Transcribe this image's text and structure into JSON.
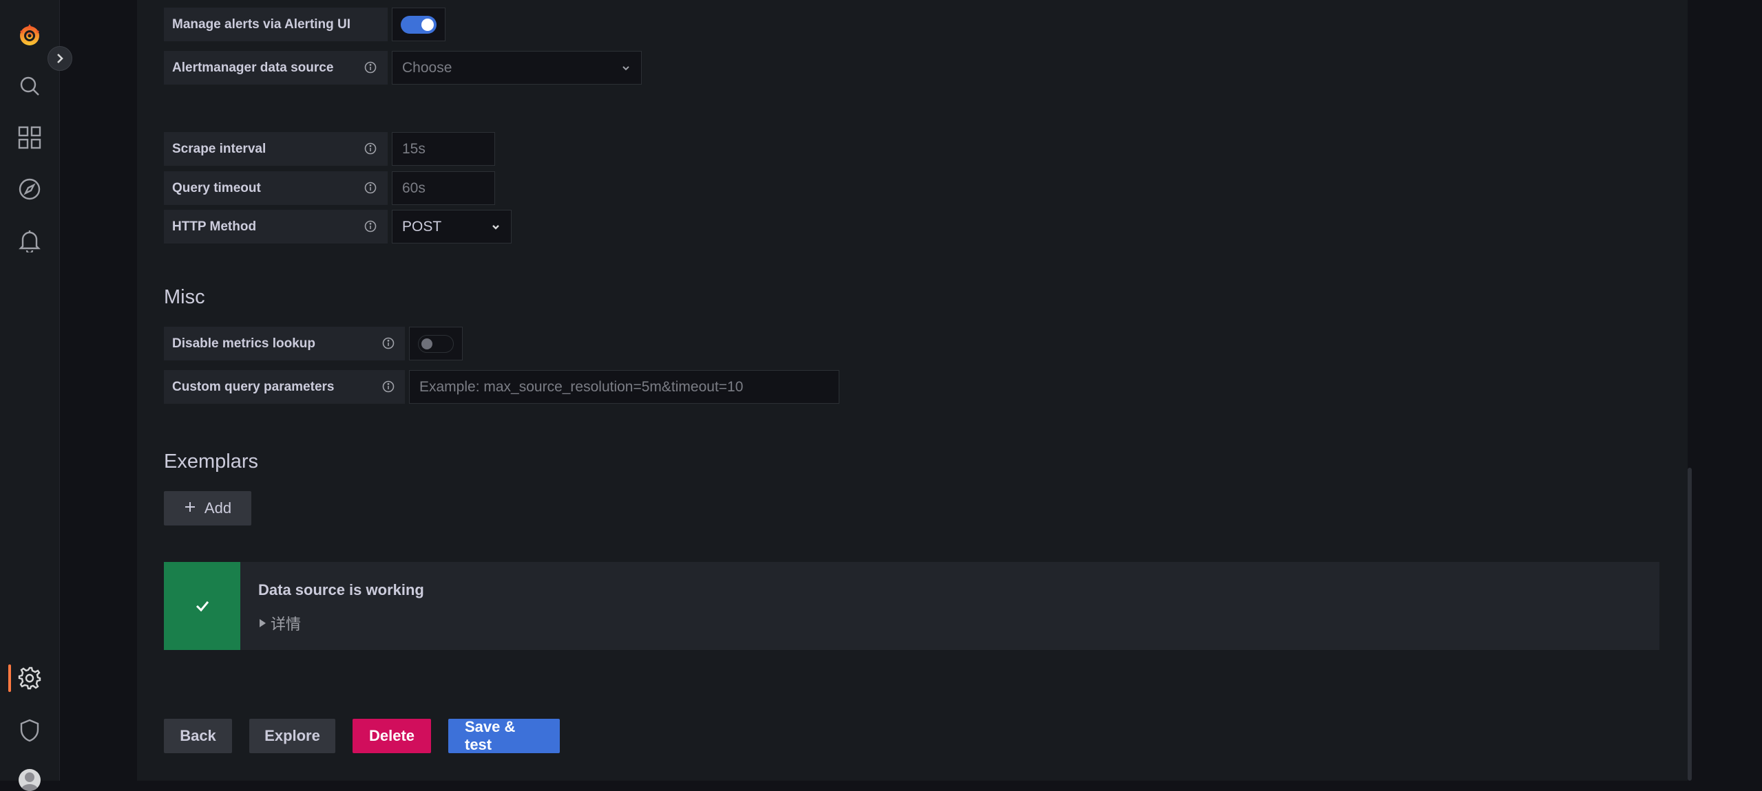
{
  "colors": {
    "accent": "#3d71d9",
    "danger": "#d10e5c",
    "success": "#1a7f4b",
    "active_indicator": "#ff7941"
  },
  "sidebar": {
    "items": [
      {
        "name": "grafana-logo-icon"
      },
      {
        "name": "search-icon"
      },
      {
        "name": "dashboards-icon"
      },
      {
        "name": "explore-compass-icon"
      },
      {
        "name": "alerting-bell-icon"
      },
      {
        "name": "configuration-gear-icon",
        "active": true
      },
      {
        "name": "server-admin-shield-icon"
      },
      {
        "name": "user-avatar"
      }
    ]
  },
  "alerting": {
    "manage_label": "Manage alerts via Alerting UI",
    "manage_enabled": true,
    "alertmanager_label": "Alertmanager data source",
    "alertmanager_placeholder": "Choose"
  },
  "http": {
    "scrape_label": "Scrape interval",
    "scrape_placeholder": "15s",
    "timeout_label": "Query timeout",
    "timeout_placeholder": "60s",
    "method_label": "HTTP Method",
    "method_value": "POST"
  },
  "misc": {
    "title": "Misc",
    "disable_lookup_label": "Disable metrics lookup",
    "disable_lookup_enabled": false,
    "custom_params_label": "Custom query parameters",
    "custom_params_placeholder": "Example: max_source_resolution=5m&timeout=10"
  },
  "exemplars": {
    "title": "Exemplars",
    "add_label": "Add"
  },
  "status": {
    "title": "Data source is working",
    "details_label": "详情"
  },
  "actions": {
    "back": "Back",
    "explore": "Explore",
    "delete": "Delete",
    "save_test": "Save & test"
  }
}
